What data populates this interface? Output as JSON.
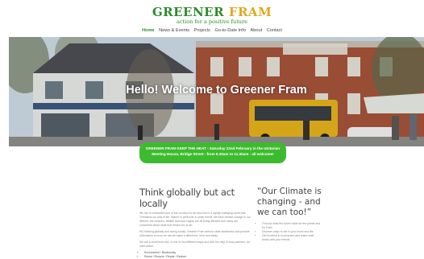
{
  "logo": {
    "word1": "GREENER",
    "word2": "FRAM",
    "tagline": "action for a positive future"
  },
  "nav": {
    "items": [
      {
        "label": "Home",
        "active": true
      },
      {
        "label": "News & Events"
      },
      {
        "label": "Projects"
      },
      {
        "label": "Go-to-Date Info"
      },
      {
        "label": "About"
      },
      {
        "label": "Contact"
      }
    ]
  },
  "hero": {
    "heading": "Hello! Welcome to Greener Fram"
  },
  "banner": {
    "text": "GREENER FRAM KEEP THE HEAT - Saturday 22nd February in the Unitarian Meeting House, Bridge Street - from 9.30am to 11.30am - all welcome!"
  },
  "colors": {
    "brand_green": "#2f8a2b",
    "brand_gold": "#e0a91c",
    "banner_green": "#3dbb2f"
  },
  "main": {
    "heading": "Think globally but act locally",
    "paragraphs": [
      "We live in a beautiful part of the country but we also live in a rapidly changing world that. Threatens our way of life. Nature in particular is under threat. We face climate change in our lifetime; the seasons, wildlife and food supply are all being affected and many are concerned about what that means for us all.",
      "Put thinking globally and acting locally: Greener Fram aims to raise awareness and provide information on how we can all make a difference, here and today.",
      "We are a small town but, in one or two different ways and with the help of local partners, we want action."
    ],
    "bullets": [
      "Environment / Biodiversity",
      "Reuse / Recycle / Repair / Reduce"
    ]
  },
  "aside": {
    "heading": "“Our Climate is changing - and we can too!”",
    "items": [
      "Find out what the future holds for the planet and for Fram",
      "Discover ways to act in your home and life",
      "Get involved in local action and share what works with your friends"
    ]
  }
}
